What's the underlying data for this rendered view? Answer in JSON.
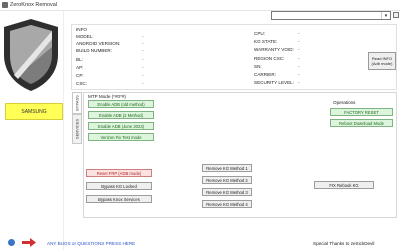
{
  "window": {
    "title": "ZeroKnox Removal"
  },
  "sidebar": {
    "brand_label": "SAMSUNG"
  },
  "device_selector": {
    "value": "",
    "arrow": "▾"
  },
  "info": {
    "left": [
      {
        "label": "INFO",
        "value": ""
      },
      {
        "label": "MODEL:",
        "value": "-"
      },
      {
        "label": "ANDROID VERSION:",
        "value": "-"
      },
      {
        "label": "BUILD NUMBER:",
        "value": "-"
      },
      {
        "label": "BL:",
        "value": "-"
      },
      {
        "label": "AP:",
        "value": "-"
      },
      {
        "label": "CP:",
        "value": "-"
      },
      {
        "label": "CSC:",
        "value": "-"
      }
    ],
    "right": [
      {
        "label": "CPU:",
        "value": "-"
      },
      {
        "label": "KG STATE:",
        "value": "-"
      },
      {
        "label": "WARRANTY VOID:",
        "value": "-"
      },
      {
        "label": "REGION CSC:",
        "value": "-"
      },
      {
        "label": "SN:",
        "value": "-"
      },
      {
        "label": "CARRIER:",
        "value": "-"
      },
      {
        "label": "SECURITY LEVEL:",
        "value": "-"
      }
    ],
    "read_info_button": {
      "line1": "Read INFO",
      "line2": "(Adb mode)"
    }
  },
  "tabs": {
    "services": "SERVICES",
    "bypass": "BYPASS"
  },
  "mtp_section": {
    "label": "MTP Mode (*#0*#)",
    "buttons": [
      "Enable ADB (old method)",
      "Enable ADB (2 Method)",
      "Enable ADB (June 2023)",
      "Verizon Fix Test mode"
    ]
  },
  "operations": {
    "label": "Operations",
    "buttons": [
      "FACTORY RESET",
      "Reboot Download Mode"
    ]
  },
  "bypass_buttons": {
    "reset_frp": "Reset FRP (ADB mode)",
    "bypass_kg": "Bypass KG Locked",
    "bypass_knox": "Bypass Knox Services"
  },
  "remove_kg": [
    "Remove KG Method 1",
    "Remove KG Method 2",
    "Remove KG Method 3",
    "Remove KG Method 4"
  ],
  "fix_rebook": "FIX Rebook KG",
  "footer": {
    "help_text": "ANY BUGS or QUESTIONS PRESS HERE",
    "thanks_text": "Special Thanks to zeSickDevil"
  },
  "colors": {
    "brand_yellow": "#ffff55",
    "green_button": "#dcf5dc",
    "red_button": "#fde2e2",
    "link_blue": "#2c55c7"
  }
}
